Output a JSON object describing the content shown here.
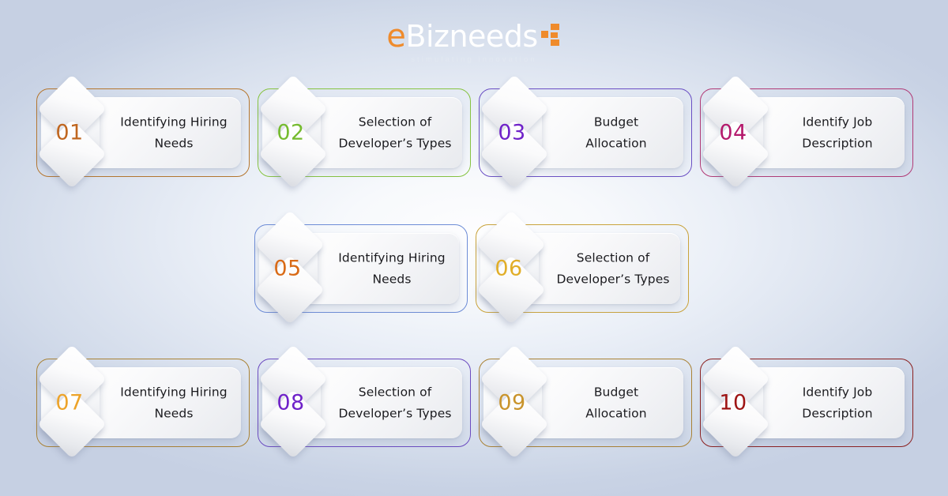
{
  "brand": {
    "name_e": "e",
    "name_rest": "Bizneeds",
    "tagline": "stimulating innovation",
    "mark_icon": "network-nodes-icon",
    "accent_color": "#ef8b2c"
  },
  "background": {
    "center_color": "#fdfdfe",
    "edge_color": "#c6d0e3"
  },
  "rows": [
    {
      "row_name": "row-1",
      "cards": [
        {
          "number": "01",
          "label": "Identifying Hiring\nNeeds",
          "accent": "#b5762e",
          "number_color": "#c0661f"
        },
        {
          "number": "02",
          "label": "Selection of\nDeveloper’s Types",
          "accent": "#86c341",
          "number_color": "#75bb2e"
        },
        {
          "number": "03",
          "label": "Budget\nAllocation",
          "accent": "#6a4fc4",
          "number_color": "#6f22c9"
        },
        {
          "number": "04",
          "label": "Identify Job\nDescription",
          "accent": "#b13a76",
          "number_color": "#b4186b"
        }
      ]
    },
    {
      "row_name": "row-2",
      "cards": [
        {
          "number": "05",
          "label": "Identifying Hiring\nNeeds",
          "accent": "#6d8cd6",
          "number_color": "#d96a16"
        },
        {
          "number": "06",
          "label": "Selection of\nDeveloper’s Types",
          "accent": "#c9a33c",
          "number_color": "#e1ae28"
        }
      ]
    },
    {
      "row_name": "row-3",
      "cards": [
        {
          "number": "07",
          "label": "Identifying Hiring\nNeeds",
          "accent": "#a98235",
          "number_color": "#eda329"
        },
        {
          "number": "08",
          "label": "Selection of\nDeveloper’s Types",
          "accent": "#6b4bc0",
          "number_color": "#6f22c9"
        },
        {
          "number": "09",
          "label": "Budget\nAllocation",
          "accent": "#a98235",
          "number_color": "#c9942c"
        },
        {
          "number": "10",
          "label": "Identify Job\nDescription",
          "accent": "#8b2020",
          "number_color": "#9e1414"
        }
      ]
    }
  ]
}
